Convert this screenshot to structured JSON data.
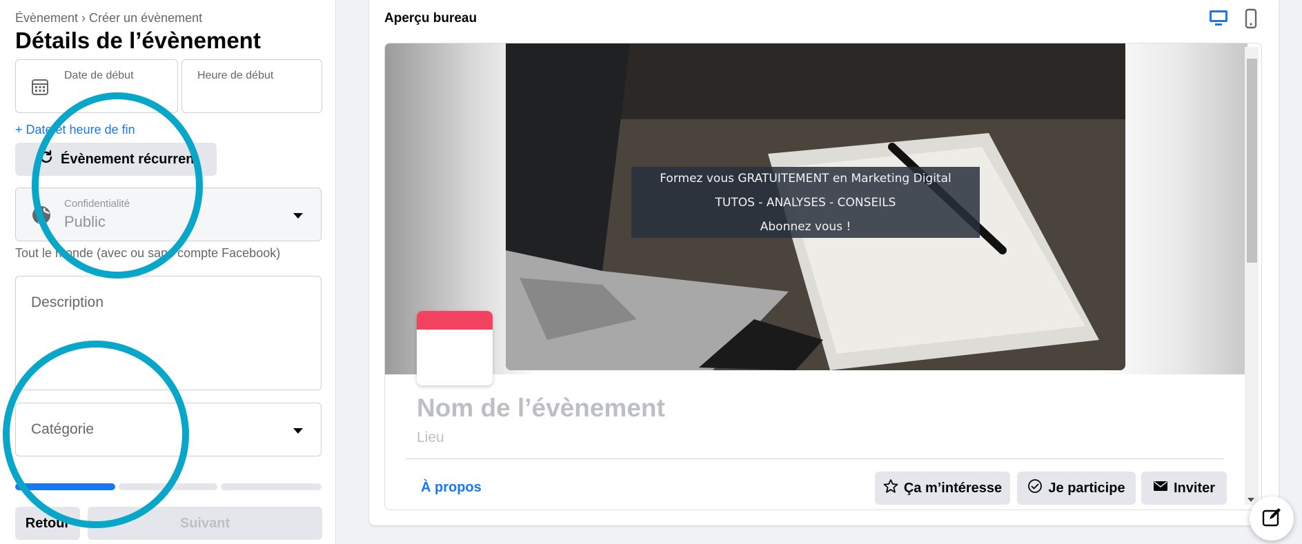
{
  "breadcrumb": "Évènement › Créer un évènement",
  "page_title": "Détails de l’évènement",
  "form": {
    "start_date_label": "Date de début",
    "start_time_label": "Heure de début",
    "add_end_link": "+ Date et heure de fin",
    "recurring_button": "Évènement récurrent",
    "privacy_label": "Confidentialité",
    "privacy_value": "Public",
    "privacy_hint": "Tout le monde (avec ou sans compte Facebook)",
    "description_placeholder": "Description",
    "category_placeholder": "Catégorie",
    "progress_fraction": 0.33,
    "back_button": "Retour",
    "next_button": "Suivant"
  },
  "preview": {
    "title": "Aperçu bureau",
    "banner_line1": "Formez vous GRATUITEMENT en Marketing Digital",
    "banner_line2": "TUTOS - ANALYSES - CONSEILS",
    "banner_line3": "Abonnez vous !",
    "event_name": "Nom de l’évènement",
    "event_place": "Lieu",
    "about_tab": "À propos",
    "interested_button": "Ça m’intéresse",
    "going_button": "Je participe",
    "invite_button": "Inviter"
  },
  "colors": {
    "accent": "#1877f2",
    "highlight_ring": "#08a6c9",
    "date_card_top": "#f3425f"
  }
}
